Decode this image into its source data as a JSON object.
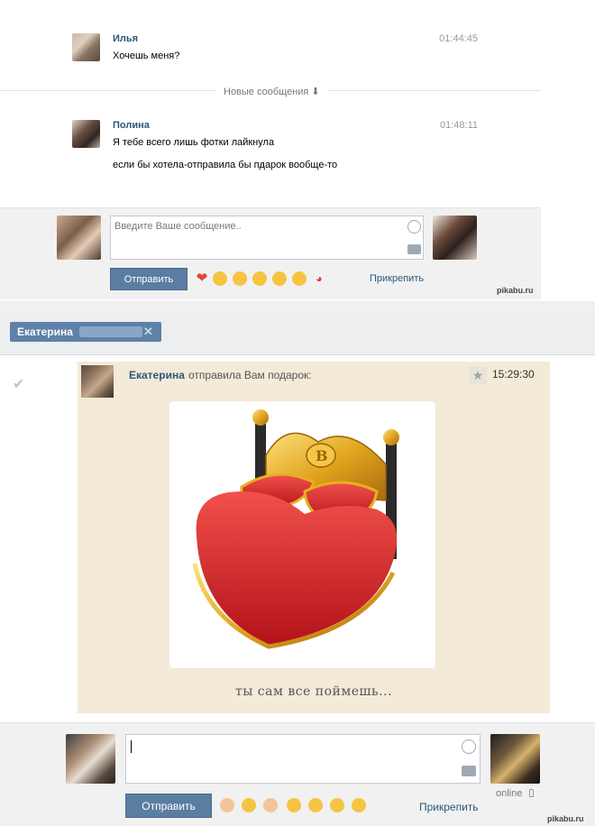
{
  "top_chat": {
    "messages": [
      {
        "name": "Илья",
        "time": "01:44:45",
        "lines": [
          "Хочешь меня?"
        ]
      },
      {
        "name": "Полина",
        "time": "01:48:11",
        "lines": [
          "Я тебе всего лишь фотки лайкнула",
          "если бы хотела-отправила бы пдарок вообще-то"
        ]
      }
    ],
    "new_messages_label": "Новые сообщения ⬇",
    "composer": {
      "placeholder": "Введите Ваше сообщение..",
      "send_label": "Отправить",
      "attach_label": "Прикрепить",
      "emojis": [
        "heart-emoji",
        "blush-emoji",
        "heart-eyes-emoji",
        "sunglasses-emoji",
        "grin-emoji",
        "smile-emoji",
        "kiss-emoji"
      ]
    },
    "watermark": "pikabu.ru"
  },
  "bottom_chat": {
    "tab": {
      "name": "Екатерина"
    },
    "gift_message": {
      "sender": "Екатерина",
      "action": "отправила Вам подарок:",
      "time": "15:29:30",
      "caption": "ты сам все поймешь..."
    },
    "composer": {
      "send_label": "Отправить",
      "attach_label": "Прикрепить",
      "online_label": "online",
      "emojis": [
        "fist-emoji",
        "sunglasses-emoji",
        "thumbs-up-emoji",
        "neutral-emoji",
        "wink-emoji",
        "relieved-emoji",
        "blush-emoji"
      ]
    },
    "watermark": "pikabu.ru"
  }
}
